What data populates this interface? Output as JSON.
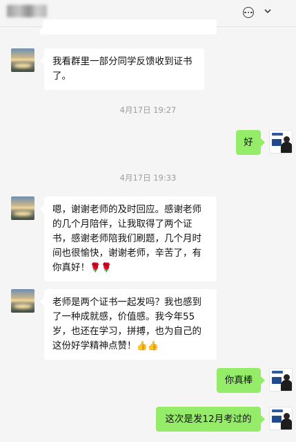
{
  "header": {
    "title_hidden": "",
    "icons": [
      "more-icon",
      "chevron-down-icon"
    ]
  },
  "messages": [
    {
      "id": "m0",
      "side": "in",
      "text": ""
    },
    {
      "id": "m1",
      "side": "in",
      "text": "我看群里一部分同学反馈收到证书了。"
    },
    {
      "id": "t1",
      "type": "time",
      "text": "4月17日 19:27"
    },
    {
      "id": "m2",
      "side": "out",
      "text": "好"
    },
    {
      "id": "t2",
      "type": "time",
      "text": "4月17日 19:33"
    },
    {
      "id": "m3",
      "side": "in",
      "text": "嗯，谢谢老师的及时回应。感谢老师的几个月陪伴，让我取得了两个证书，感谢老师陪我们刷题，几个月时间也很愉快，谢谢老师，辛苦了，有你真好！",
      "emoji": "🌹🌹"
    },
    {
      "id": "m4",
      "side": "in",
      "text": "老师是两个证书一起发吗？我也感到了一种成就感，价值感。我今年55岁，也还在学习，拼搏，也为自己的这份好学精神点赞！",
      "emoji": "👍👍"
    },
    {
      "id": "m5",
      "side": "out",
      "text": "你真棒"
    },
    {
      "id": "m6",
      "side": "out",
      "text": "这次是发12月考过的"
    }
  ],
  "colors": {
    "background": "#f5f5f5",
    "incoming_bubble": "#ffffff",
    "outgoing_bubble": "#95ec69",
    "timestamp": "#9c9c9c"
  }
}
